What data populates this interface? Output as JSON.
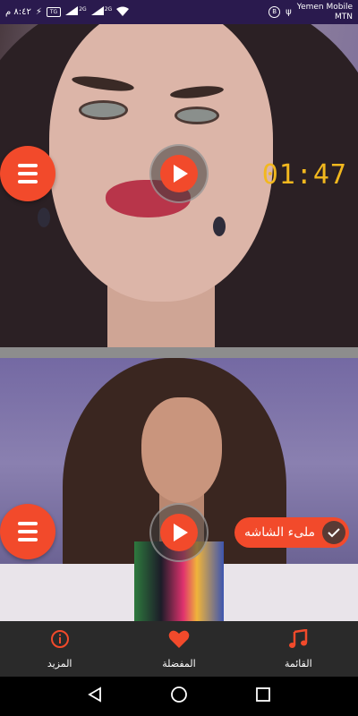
{
  "status_bar": {
    "time": "٨:٤٢ م",
    "carrier_line1": "Yemen Mobile",
    "carrier_line2": "MTN",
    "network_badge": "TG",
    "signal_label_1": "2G",
    "signal_label_2": "2G",
    "circle_badge": "B"
  },
  "videos": [
    {
      "timer": "01:47"
    },
    {
      "fullscreen_label": "ملىء الشاشه"
    }
  ],
  "bottom_nav": {
    "items": [
      {
        "label": "المزيد",
        "icon": "info-icon"
      },
      {
        "label": "المفضلة",
        "icon": "heart-icon"
      },
      {
        "label": "القائمة",
        "icon": "music-note-icon"
      }
    ]
  },
  "colors": {
    "accent": "#f24a2b",
    "timer": "#f2b81e",
    "status_bar": "#2a1a4e",
    "nav_bg": "#2a2a2a"
  }
}
